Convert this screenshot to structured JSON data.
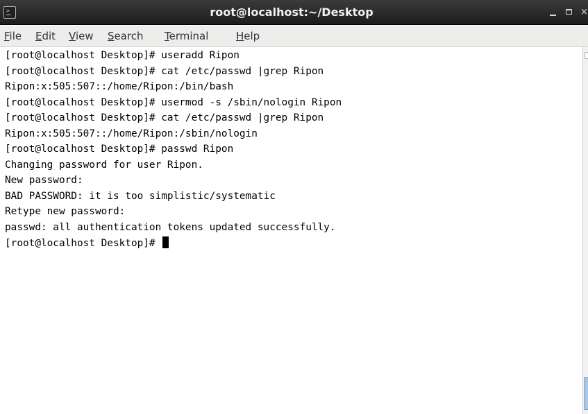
{
  "window": {
    "title": "root@localhost:~/Desktop",
    "icon": "terminal-icon",
    "controls": {
      "minimize": "minimize-icon",
      "maximize": "maximize-icon",
      "close": "×"
    }
  },
  "menubar": {
    "items": [
      "File",
      "Edit",
      "View",
      "Search",
      "Terminal",
      "Help"
    ]
  },
  "terminal": {
    "lines": [
      "[root@localhost Desktop]# useradd Ripon",
      "[root@localhost Desktop]# cat /etc/passwd |grep Ripon",
      "Ripon:x:505:507::/home/Ripon:/bin/bash",
      "[root@localhost Desktop]# usermod -s /sbin/nologin Ripon",
      "[root@localhost Desktop]# cat /etc/passwd |grep Ripon",
      "Ripon:x:505:507::/home/Ripon:/sbin/nologin",
      "[root@localhost Desktop]# passwd Ripon",
      "Changing password for user Ripon.",
      "New password:",
      "BAD PASSWORD: it is too simplistic/systematic",
      "Retype new password:",
      "passwd: all authentication tokens updated successfully."
    ],
    "prompt": "[root@localhost Desktop]# "
  },
  "colors": {
    "titlebar": "#2a2a2a",
    "menubar": "#ededeb",
    "terminal_bg": "#ffffff",
    "terminal_fg": "#000000",
    "scroll_thumb": "#a9c6e3"
  }
}
